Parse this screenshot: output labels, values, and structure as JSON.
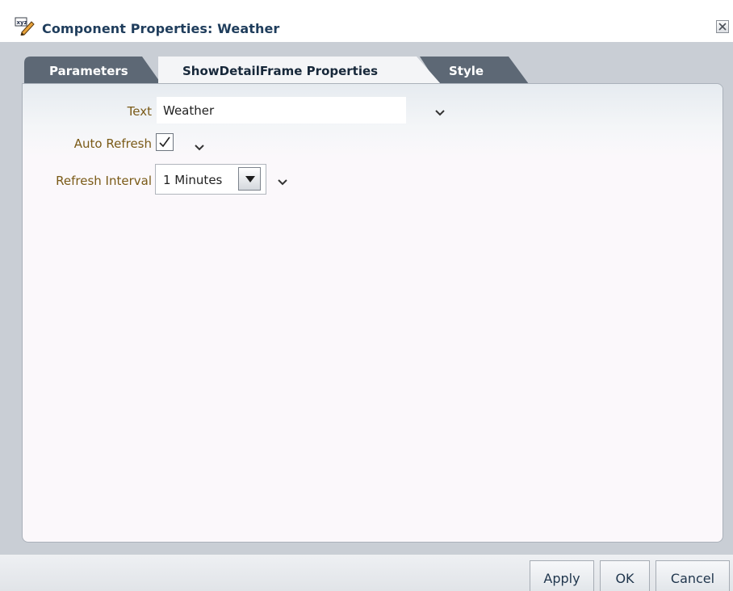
{
  "dialog": {
    "title": "Component Properties: Weather",
    "title_icon": "edit-properties-icon",
    "close_icon": "close-icon"
  },
  "tabs": [
    {
      "label": "Parameters",
      "active": false
    },
    {
      "label": "ShowDetailFrame Properties",
      "active": true
    },
    {
      "label": "Style",
      "active": false
    }
  ],
  "form": {
    "text": {
      "label": "Text",
      "value": "Weather"
    },
    "auto_refresh": {
      "label": "Auto Refresh",
      "checked": true
    },
    "refresh_interval": {
      "label": "Refresh Interval",
      "selected": "1 Minutes"
    },
    "menu_icon": "chevron-down-icon"
  },
  "buttons": {
    "apply": "Apply",
    "ok": "OK",
    "cancel": "Cancel"
  },
  "colors": {
    "title": "#1f3d5c",
    "label": "#7a5a17",
    "tab_inactive": "#5d6875",
    "tab_active": "#f4f5f7",
    "background": "#c9ced5"
  }
}
